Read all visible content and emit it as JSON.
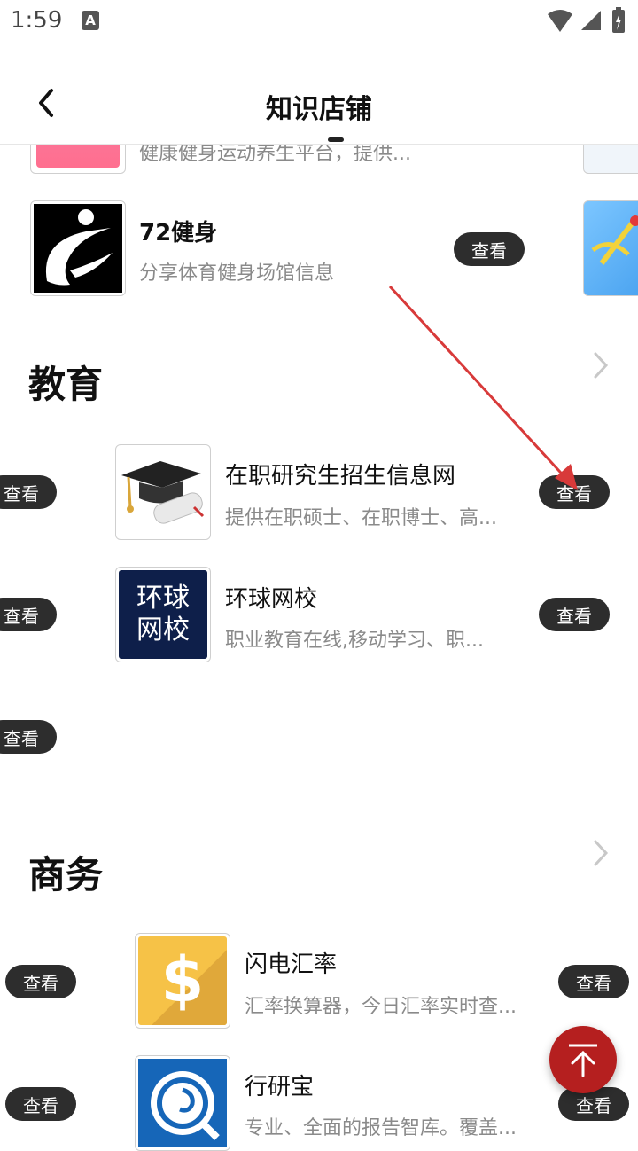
{
  "status": {
    "time": "1:59",
    "notif_icon_letter": "A"
  },
  "nav": {
    "title": "知识店铺"
  },
  "top_partial": {
    "desc": "健康健身运动养生平台，提供..."
  },
  "fitness_item": {
    "title": "72健身",
    "desc": "分享体育健身场馆信息",
    "button": "查看"
  },
  "education": {
    "title": "教育",
    "items": [
      {
        "title": "在职研究生招生信息网",
        "desc": "提供在职硕士、在职博士、高...",
        "button": "查看"
      },
      {
        "title": "环球网校",
        "desc": "职业教育在线,移动学习、职...",
        "button": "查看",
        "logo_text_line1": "环球",
        "logo_text_line2": "网校"
      }
    ],
    "left_buttons": [
      "查看",
      "查看",
      "查看"
    ]
  },
  "business": {
    "title": "商务",
    "items": [
      {
        "title": "闪电汇率",
        "desc": "汇率换算器，今日汇率实时查...",
        "button": "查看",
        "logo_symbol": "$"
      },
      {
        "title": "行研宝",
        "desc": "专业、全面的报告智库。覆盖...",
        "button": "查看"
      }
    ],
    "left_buttons": [
      "查看",
      "查看"
    ]
  },
  "colors": {
    "accent_fab": "#b51f1f",
    "button_bg": "#2d2d2d",
    "annotation_arrow": "#d83a3a"
  }
}
